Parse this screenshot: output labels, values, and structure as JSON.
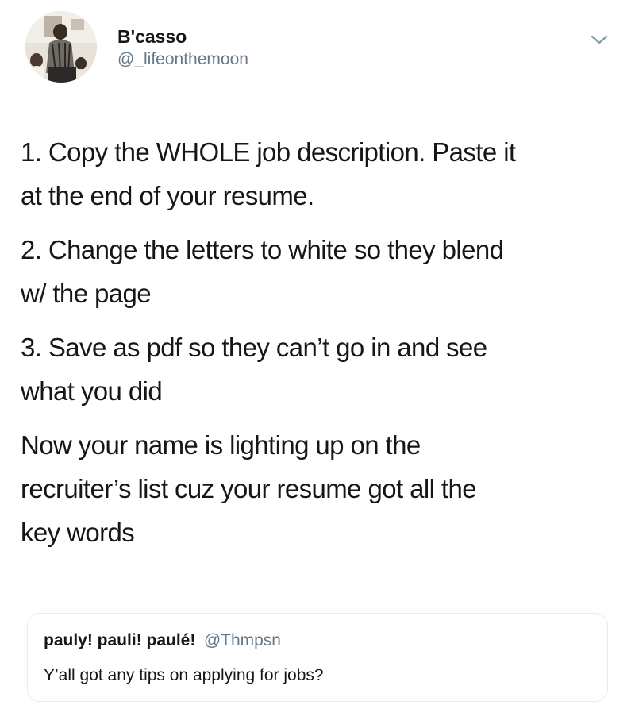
{
  "tweet": {
    "author": {
      "display_name": "B'casso",
      "handle": "@_lifeonthemoon",
      "avatar": "profile-photo"
    },
    "menu_icon": "chevron-down-icon",
    "paragraphs": [
      {
        "lines": [
          "1. Copy the WHOLE job description. Paste it",
          "at the end of your resume."
        ]
      },
      {
        "lines": [
          "2. Change the letters to white so they blend",
          "w/ the page"
        ]
      },
      {
        "lines": [
          "3. Save as pdf so they can’t go in and see",
          "what you did"
        ]
      },
      {
        "lines": [
          "Now your name is lighting up on the",
          "recruiter’s list cuz your resume got all the",
          "key words"
        ]
      }
    ],
    "quoted_tweet": {
      "display_name": "pauly! pauli! paulé!",
      "handle": "@Thmpsn",
      "text": "Y’all got any tips on applying for jobs?"
    }
  },
  "colors": {
    "text_primary": "#14171a",
    "text_secondary": "#657786",
    "border": "#e6ecf0"
  }
}
